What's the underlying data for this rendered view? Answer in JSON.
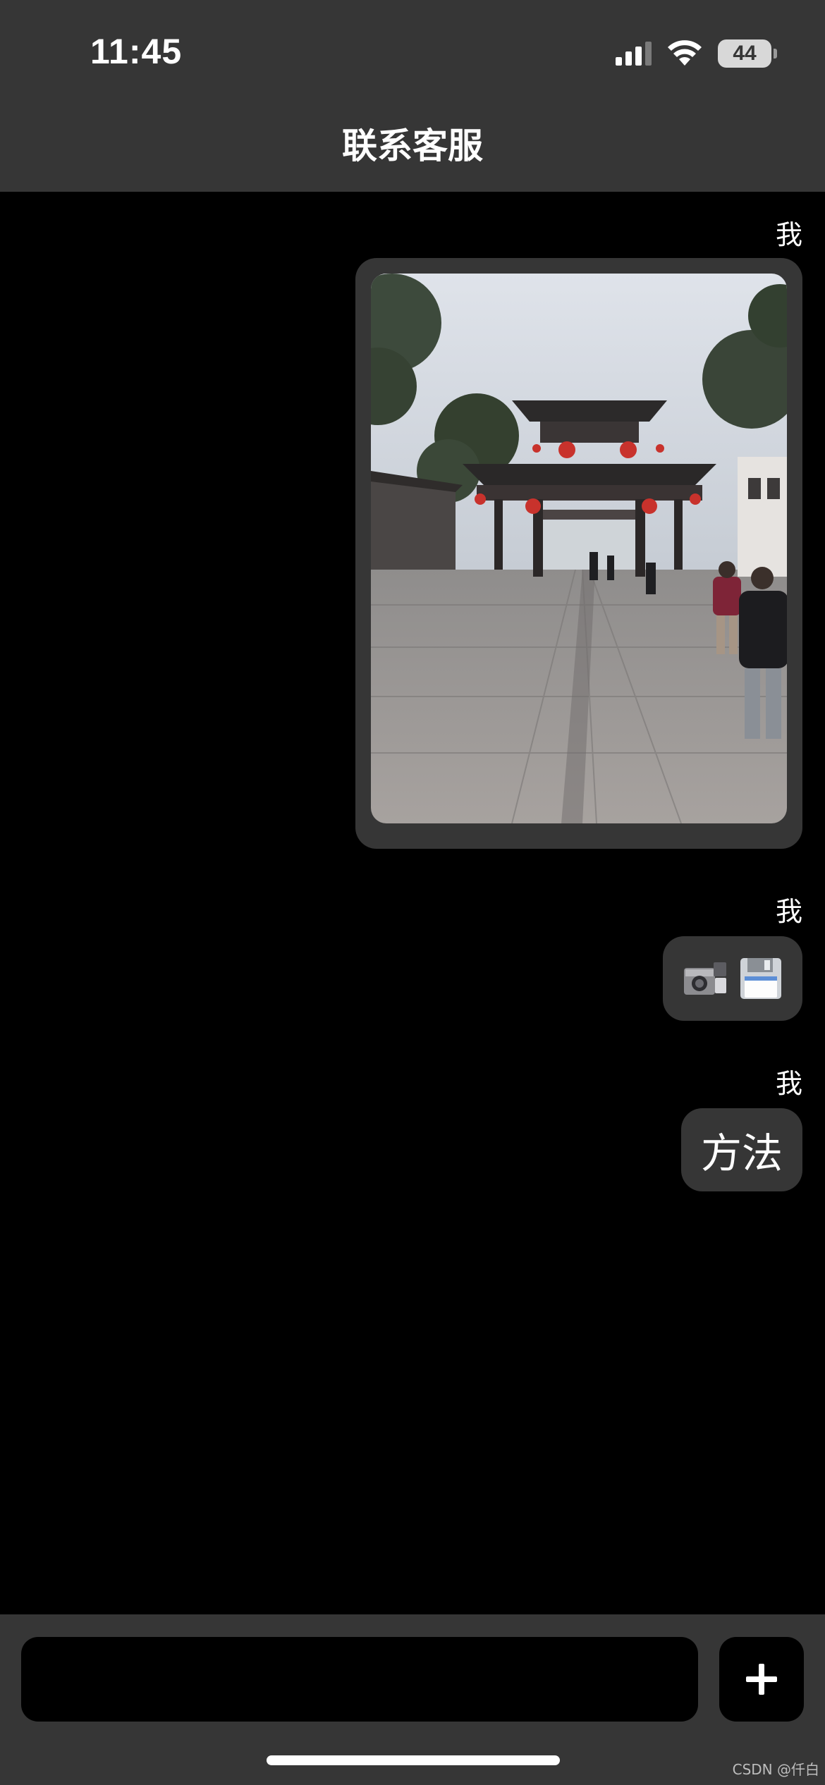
{
  "status_bar": {
    "time": "11:45",
    "battery_level": "44",
    "icons": [
      "signal-icon",
      "wifi-icon",
      "battery-icon"
    ]
  },
  "nav": {
    "title": "联系客服"
  },
  "messages": [
    {
      "sender": "我",
      "type": "image",
      "content": "photo of a traditional Chinese gate with red lanterns"
    },
    {
      "sender": "我",
      "type": "icons",
      "icons": [
        "video-camera-icon",
        "floppy-disk-icon"
      ]
    },
    {
      "sender": "我",
      "type": "text",
      "text": "方法"
    }
  ],
  "input_bar": {
    "message_value": "",
    "plus_label": "+"
  },
  "watermark": "CSDN @仟白",
  "colors": {
    "bar_background": "#363636",
    "chat_background": "#000000",
    "bubble_background": "#363636",
    "text": "#ffffff"
  }
}
